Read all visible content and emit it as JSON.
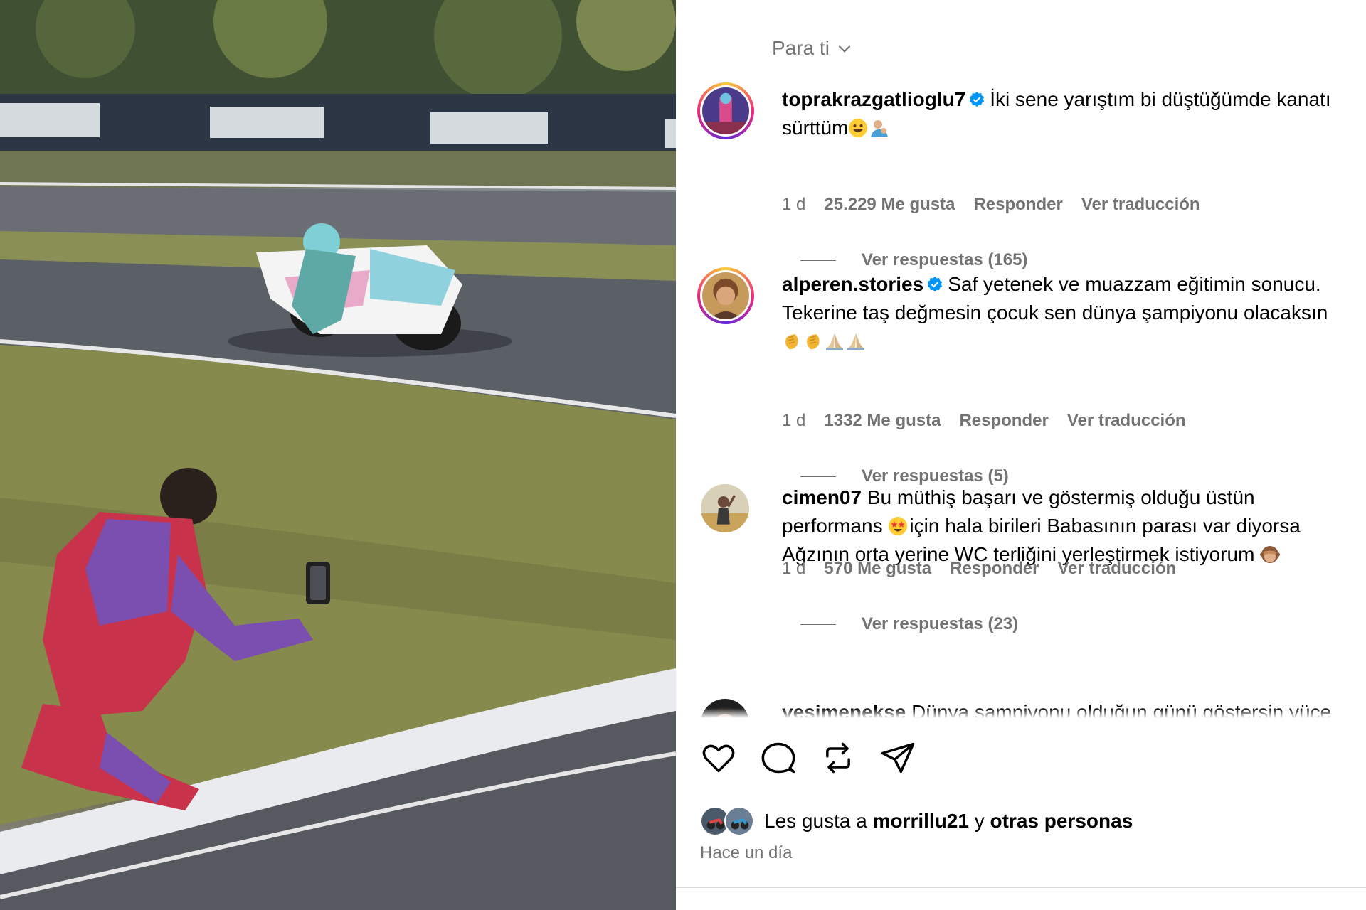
{
  "media": {
    "description_icon": "video-thumbnail"
  },
  "header": {
    "feed_label": "Para ti"
  },
  "comments": [
    {
      "username": "toprakrazgatlioglu7",
      "verified": true,
      "text": "İki sene yarıştım bi düştüğümde kanatı sürttüm",
      "emojis": [
        "grinning-face-emoji",
        "person-emoji"
      ],
      "age": "1 d",
      "likes": "25.229 Me gusta",
      "reply": "Responder",
      "translate": "Ver traducción",
      "replies": "Ver respuestas (165)"
    },
    {
      "username": "alperen.stories",
      "verified": true,
      "text": "Saf yetenek ve muazzam eğitimin sonucu. Tekerine taş değmesin çocuk sen dünya şampiyonu olacaksın",
      "emojis": [
        "clapping-hands-emoji",
        "clapping-hands-emoji",
        "folded-hands-emoji",
        "folded-hands-emoji"
      ],
      "age": "1 d",
      "likes": "1332 Me gusta",
      "reply": "Responder",
      "translate": "Ver traducción",
      "replies": "Ver respuestas (5)"
    },
    {
      "username": "cimen07",
      "verified": false,
      "text_before": "Bu müthiş başarı ve göstermiş olduğu üstün performans",
      "text_after": "için hala birileri Babasının parası var diyorsa Ağzının orta yerine WC terliğini yerleştirmek istiyorum",
      "emojis": [
        "star-struck-emoji",
        "see-no-evil-monkey-emoji"
      ],
      "age": "1 d",
      "likes": "570 Me gusta",
      "reply": "Responder",
      "translate": "Ver traducción",
      "replies": "Ver respuestas (23)"
    },
    {
      "username": "yesimenekse",
      "verified": false,
      "text": "Dünya şampiyonu olduğun günü göstersin yüce"
    }
  ],
  "actions": {
    "like": "heart-icon",
    "comment": "comment-icon",
    "repost": "repost-icon",
    "share": "share-icon"
  },
  "likes_summary": {
    "prefix": "Les gusta a",
    "user": "morrillu21",
    "connector": "y",
    "others": "otras personas"
  },
  "posted": "Hace un día",
  "colors": {
    "muted_text": "#737373",
    "verified_blue": "#0095f6"
  }
}
